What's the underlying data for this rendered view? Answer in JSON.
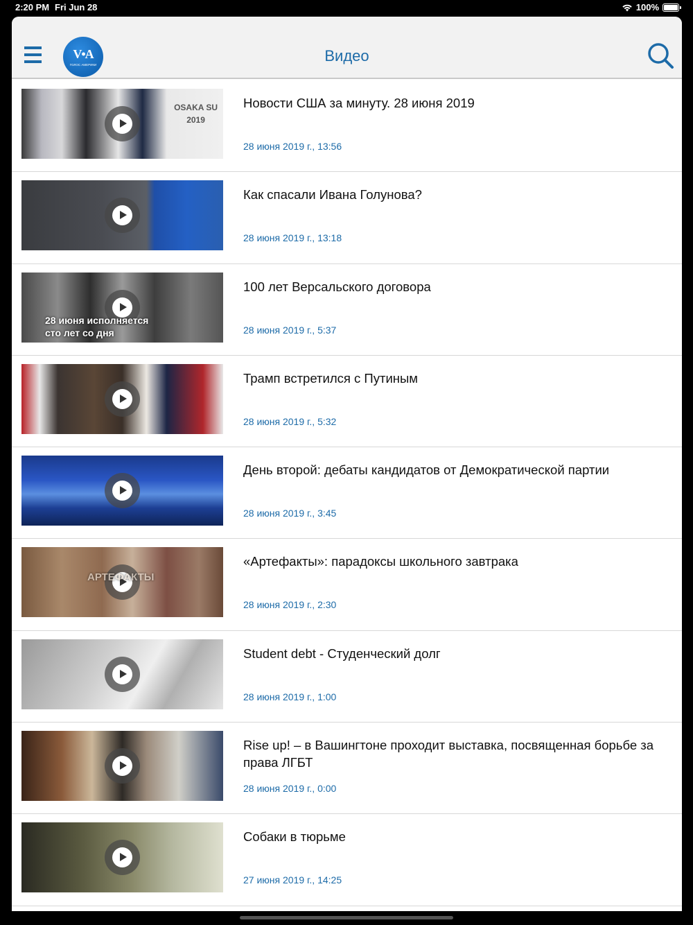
{
  "status_bar": {
    "time": "2:20 PM",
    "date": "Fri Jun 28",
    "battery_text": "100%",
    "battery_level": 1.0,
    "wifi_icon": "wifi-icon"
  },
  "header": {
    "title": "Видео",
    "logo_text": "V•A",
    "logo_subtext": "ГОЛОС АМЕРИКИ",
    "menu_icon": "hamburger-menu-icon",
    "search_icon": "search-icon",
    "accent_color": "#1d6ba8"
  },
  "videos": [
    {
      "title": "Новости США за минуту. 28 июня 2019",
      "date": "28 июня 2019 г., 13:56",
      "thumb_text": "OSAKA SU\n2019"
    },
    {
      "title": "Как спасали Ивана Голунова?",
      "date": "28 июня 2019 г., 13:18",
      "thumb_text": ""
    },
    {
      "title": "100 лет Версальского договора",
      "date": "28 июня 2019 г., 5:37",
      "thumb_text": "28 июня исполняется\nсто лет со дня"
    },
    {
      "title": "Трамп встретился с Путиным",
      "date": "28 июня 2019 г., 5:32",
      "thumb_text": ""
    },
    {
      "title": "День второй: дебаты кандидатов от Демократической партии",
      "date": "28 июня 2019 г., 3:45",
      "thumb_text": ""
    },
    {
      "title": "«Артефакты»: парадоксы школьного завтрака",
      "date": "28 июня 2019 г., 2:30",
      "thumb_text": "АРТЕФАКТЫ"
    },
    {
      "title": "Student debt - Студенческий долг",
      "date": "28 июня 2019 г., 1:00",
      "thumb_text": ""
    },
    {
      "title": "Rise up! – в Вашингтоне проходит выставка, посвященная борьбе за права ЛГБТ",
      "date": "28 июня 2019 г., 0:00",
      "thumb_text": ""
    },
    {
      "title": "Собаки в тюрьме",
      "date": "27 июня 2019 г., 14:25",
      "thumb_text": ""
    }
  ]
}
